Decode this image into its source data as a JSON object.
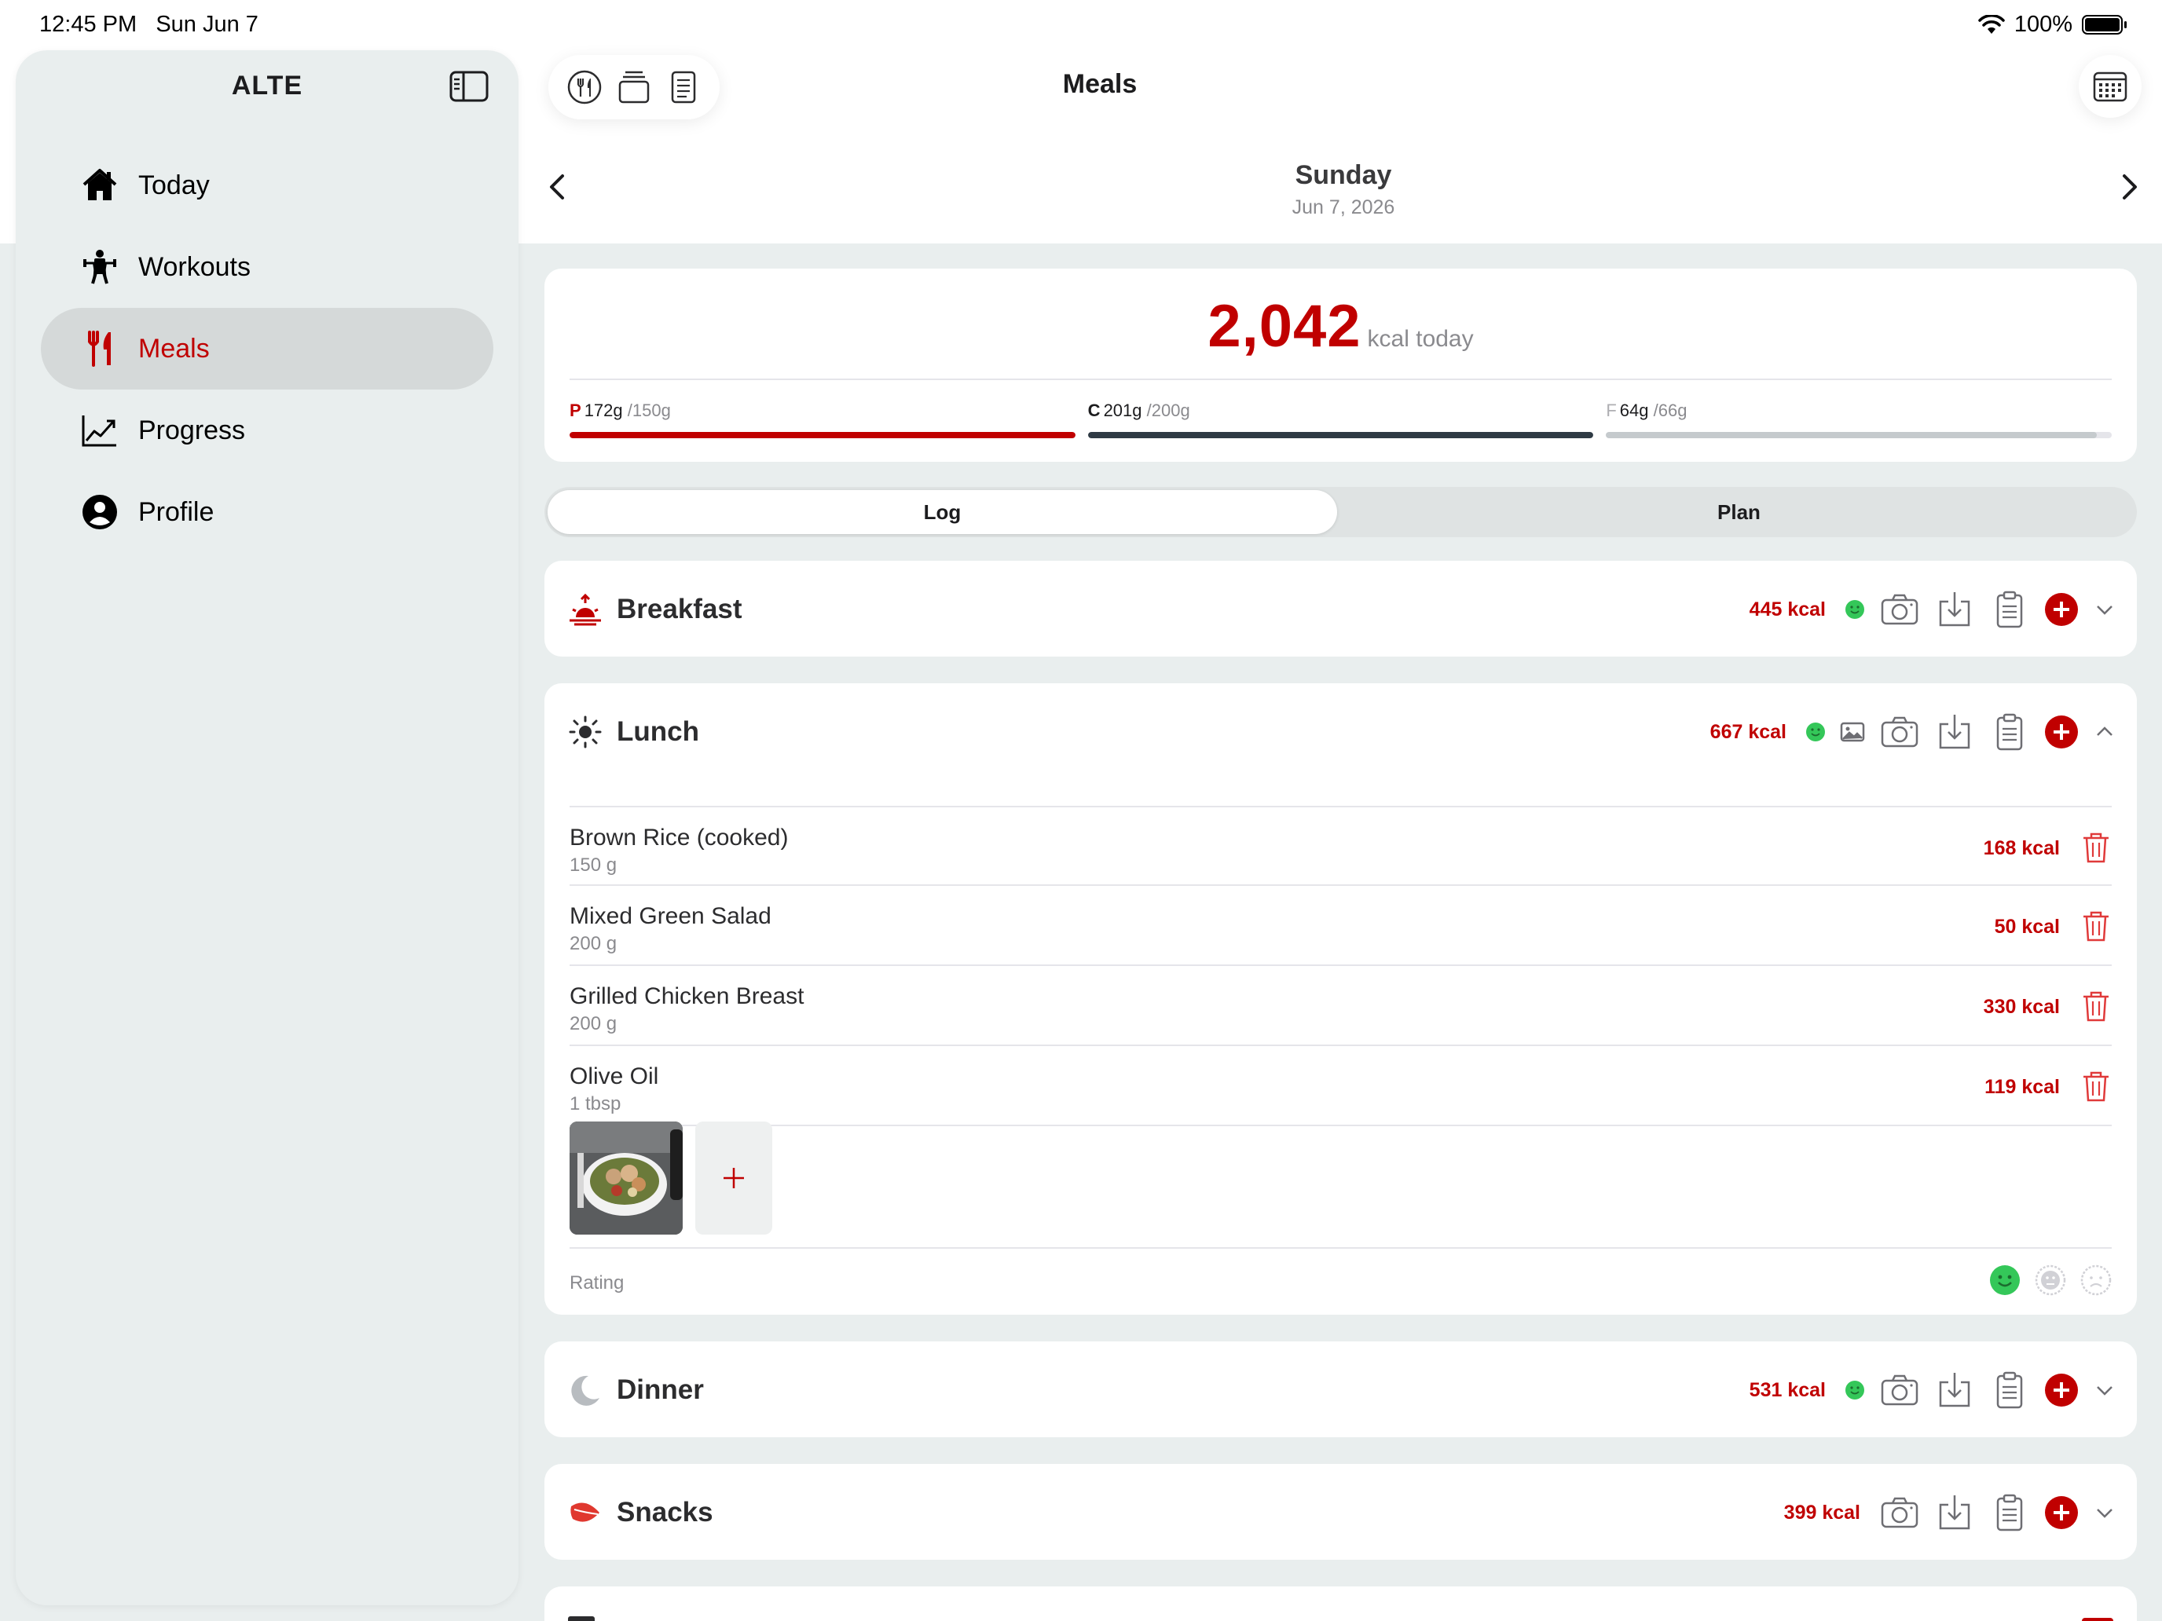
{
  "status": {
    "time": "12:45 PM",
    "date": "Sun Jun 7",
    "battery": "100%"
  },
  "sidebar": {
    "title": "ALTE",
    "items": [
      {
        "label": "Today",
        "icon": "house-icon"
      },
      {
        "label": "Workouts",
        "icon": "weightlifter-icon"
      },
      {
        "label": "Meals",
        "icon": "fork-knife-icon"
      },
      {
        "label": "Progress",
        "icon": "chart-line-icon"
      },
      {
        "label": "Profile",
        "icon": "person-circle-icon"
      }
    ],
    "active": "Meals"
  },
  "header": {
    "title": "Meals"
  },
  "day": {
    "name": "Sunday",
    "date": "Jun 7, 2026"
  },
  "summary": {
    "kcal": "2,042",
    "kcal_label": "kcal today",
    "macros": [
      {
        "letter": "P",
        "current": "172g",
        "goal": "/150g",
        "fraction": 1.0,
        "color": "#c00000"
      },
      {
        "letter": "C",
        "current": "201g",
        "goal": "/200g",
        "fraction": 1.0,
        "color": "#2f3a44"
      },
      {
        "letter": "F",
        "current": "64g",
        "goal": "/66g",
        "fraction": 0.97,
        "color": "#c5cacd"
      }
    ]
  },
  "segment": {
    "log": "Log",
    "plan": "Plan",
    "selected": "Log"
  },
  "meals": {
    "breakfast": {
      "name": "Breakfast",
      "kcal": "445 kcal"
    },
    "lunch": {
      "name": "Lunch",
      "kcal": "667 kcal",
      "items": [
        {
          "name": "Brown Rice (cooked)",
          "qty": "150 g",
          "kcal": "168 kcal"
        },
        {
          "name": "Mixed Green Salad",
          "qty": "200 g",
          "kcal": "50 kcal"
        },
        {
          "name": "Grilled Chicken Breast",
          "qty": "200 g",
          "kcal": "330 kcal"
        },
        {
          "name": "Olive Oil",
          "qty": "1 tbsp",
          "kcal": "119 kcal"
        }
      ],
      "rating_label": "Rating"
    },
    "dinner": {
      "name": "Dinner",
      "kcal": "531 kcal"
    },
    "snacks": {
      "name": "Snacks",
      "kcal": "399 kcal"
    }
  },
  "colors": {
    "accent": "#c00000",
    "rating_green": "#34c759",
    "background": "#e9eeee"
  }
}
